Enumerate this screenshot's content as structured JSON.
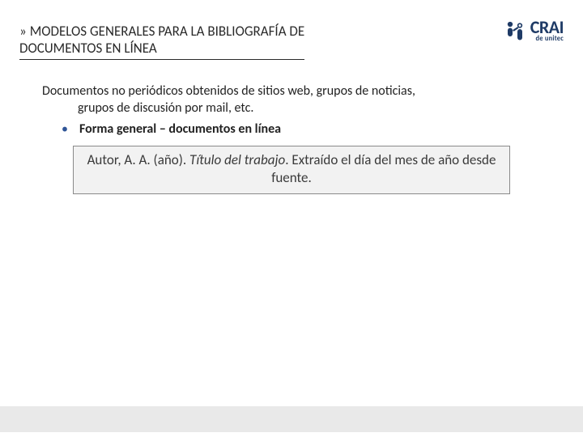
{
  "header": {
    "prefix": "»",
    "title_line1": "MODELOS GENERALES PARA LA BIBLIOGRAFÍA DE",
    "title_line2": "DOCUMENTOS EN LÍNEA"
  },
  "logo": {
    "main": "CRAI",
    "sub": "de unitec"
  },
  "content": {
    "para_line1": "Documentos no periódicos obtenidos de sitios web, grupos de noticias,",
    "para_line2": "grupos de discusión por mail, etc.",
    "bullet_text": "Forma general – documentos en línea"
  },
  "format_box": {
    "seg1": "Autor, A. A. (año). ",
    "seg_italic": "Título del trabajo",
    "seg2": ". Extraído el día del mes de año desde fuente."
  }
}
